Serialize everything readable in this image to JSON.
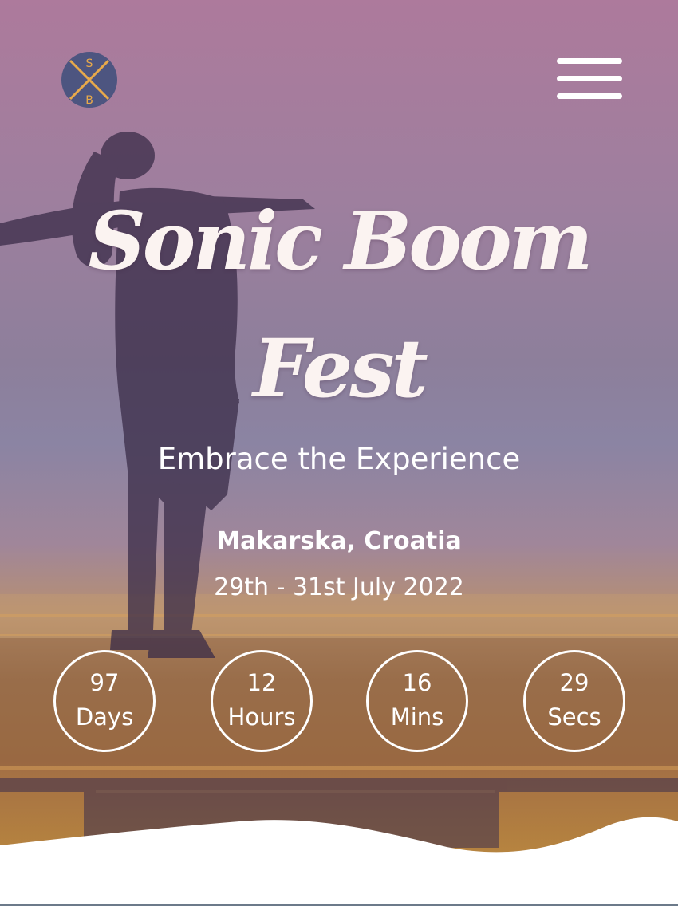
{
  "header": {
    "logo": {
      "letter_top": "S",
      "letter_bottom": "B",
      "icon": "sb-logo",
      "fill_color": "#4d5580",
      "accent_color": "#e8a94a"
    },
    "menu_icon": "hamburger-menu-icon"
  },
  "hero": {
    "title": "Sonic Boom Fest",
    "tagline": "Embrace the Experience",
    "location": "Makarska, Croatia",
    "dates": "29th - 31st July 2022"
  },
  "countdown": [
    {
      "value": "97",
      "unit": "Days"
    },
    {
      "value": "12",
      "unit": "Hours"
    },
    {
      "value": "16",
      "unit": "Mins"
    },
    {
      "value": "29",
      "unit": "Secs"
    }
  ],
  "colors": {
    "gradient_top": "#ad7a9c",
    "gradient_middle": "#8b84a3",
    "gradient_bottom": "#c39240",
    "text": "#ffffff",
    "title_text": "#fbf3f1"
  }
}
